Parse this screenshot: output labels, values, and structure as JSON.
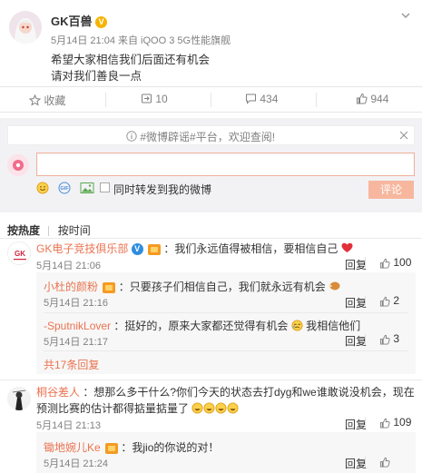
{
  "post": {
    "author": "GK百兽",
    "meta": "5月14日 21:04 来自 iQOO 3 5G性能旗舰",
    "line1": "希望大家相信我们后面还有机会",
    "line2": "请对我们善良一点"
  },
  "actions": {
    "favorite": "收藏",
    "repost": "10",
    "comments": "434",
    "likes": "944"
  },
  "notice": {
    "text": "#微博辟谣#平台，欢迎查阅!"
  },
  "composer": {
    "input_value": "",
    "repost_label": "同时转发到我的微博",
    "submit": "评论"
  },
  "sort": {
    "hot": "按热度",
    "time": "按时间"
  },
  "comments": [
    {
      "user": "GK电子竞技俱乐部",
      "text": "：我们永远值得被相信，要相信自己",
      "time": "5月14日 21:06",
      "reply": "回复",
      "likes": "100",
      "replies": [
        {
          "user": "小杜的颜粉",
          "text": "：只要孩子们相信自己，我们就永远有机会",
          "time": "5月14日 21:16",
          "reply": "回复",
          "likes": "2"
        },
        {
          "user": "-SputnikLover",
          "text_a": "：挺好的，原来大家都还觉得有机会",
          "text_b": "我相信他们",
          "time": "5月14日 21:17",
          "reply": "回复",
          "likes": "3"
        }
      ],
      "more": "共17条回复"
    },
    {
      "user": "桐谷差人",
      "text1": "：想那么多干什么?你们今天的状态去打dyg和we谁敢说没机会，现在",
      "text2": "预测比赛的估计都得掂量掂量了",
      "time": "5月14日 21:13",
      "reply": "回复",
      "likes": "109",
      "replies": [
        {
          "user": "锄地婉儿Ke",
          "text": "：我jio的你说的对！",
          "time": "5月14日 21:24",
          "reply": "回复"
        }
      ]
    }
  ]
}
